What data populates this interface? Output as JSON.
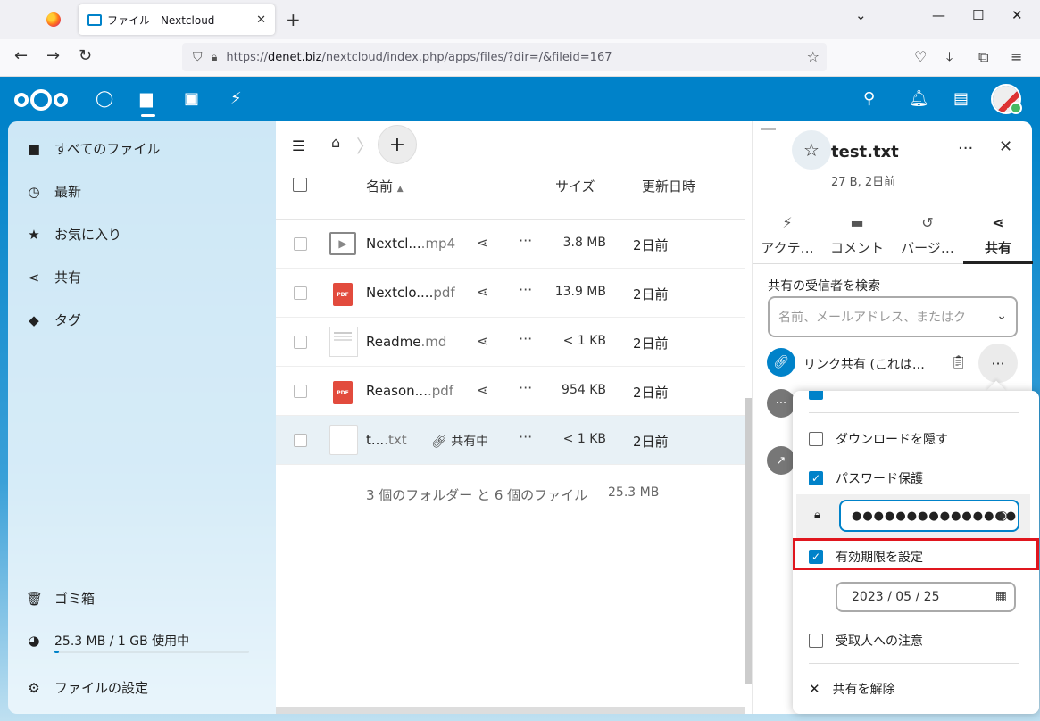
{
  "browser": {
    "tab_title": "ファイル - Nextcloud",
    "url_prefix": "https://",
    "url_domain": "denet.biz",
    "url_path": "/nextcloud/index.php/apps/files/?dir=/&fileid=167"
  },
  "sidebar": {
    "items": [
      {
        "label": "すべてのファイル",
        "icon": "folder-icon"
      },
      {
        "label": "最新",
        "icon": "clock-icon"
      },
      {
        "label": "お気に入り",
        "icon": "star-icon"
      },
      {
        "label": "共有",
        "icon": "share-icon"
      },
      {
        "label": "タグ",
        "icon": "tag-icon"
      }
    ],
    "trash": "ゴミ箱",
    "quota": "25.3 MB / 1 GB 使用中",
    "quota_fraction": 0.025,
    "settings": "ファイルの設定"
  },
  "files": {
    "columns": {
      "name": "名前",
      "size": "サイズ",
      "modified": "更新日時"
    },
    "rows": [
      {
        "name": "Nextcl...",
        "ext": ".mp4",
        "size": "3.8 MB",
        "modified": "2日前",
        "type": "video"
      },
      {
        "name": "Nextclo....",
        "ext": "pdf",
        "size": "13.9 MB",
        "modified": "2日前",
        "type": "pdf"
      },
      {
        "name": "Readme",
        "ext": ".md",
        "size": "< 1 KB",
        "modified": "2日前",
        "type": "doc"
      },
      {
        "name": "Reason...",
        "ext": ".pdf",
        "size": "954 KB",
        "modified": "2日前",
        "type": "pdf"
      },
      {
        "name": "t...",
        "ext": ".txt",
        "size": "< 1 KB",
        "modified": "2日前",
        "type": "txt",
        "shared_label": "共有中"
      }
    ],
    "summary": "3 個のフォルダー と 6 個のファイル",
    "summary_size": "25.3 MB"
  },
  "details": {
    "title": "test.txt",
    "subtitle": "27 B, 2日前",
    "tabs": [
      "アクテ…",
      "コメント",
      "バージ…",
      "共有"
    ],
    "search_label": "共有の受信者を検索",
    "search_placeholder": "名前、メールアドレス、またはク",
    "link_label": "リンク共有 (これは…"
  },
  "menu": {
    "hide_download": "ダウンロードを隠す",
    "password_protect": "パスワード保護",
    "password_value": "●●●●●●●●●●●●●●●",
    "set_expiration": "有効期限を設定",
    "expiration_date": "2023 / 05 / 25",
    "note_to_recipient": "受取人への注意",
    "unshare": "共有を解除"
  }
}
